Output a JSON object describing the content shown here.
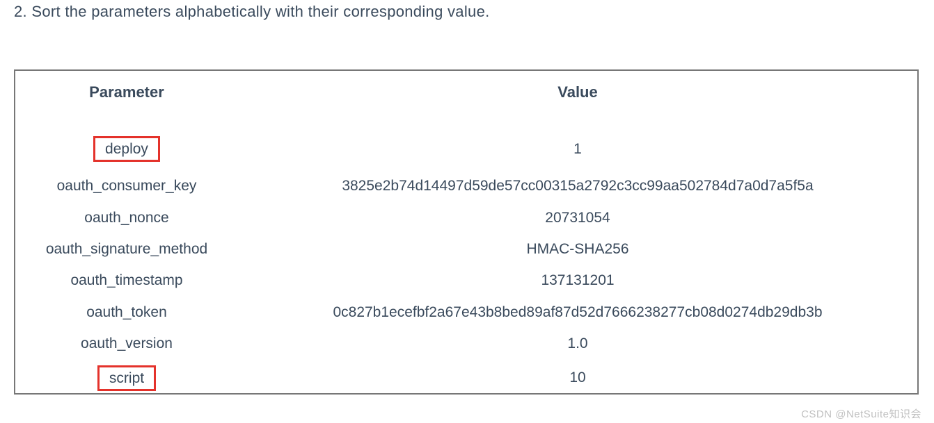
{
  "instruction": {
    "number": "2.",
    "text": "Sort the parameters alphabetically with their corresponding value."
  },
  "table": {
    "headers": {
      "param": "Parameter",
      "value": "Value"
    },
    "rows": [
      {
        "param": "deploy",
        "value": "1",
        "highlight": true,
        "cls": "row-deploy"
      },
      {
        "param": "oauth_consumer_key",
        "value": "3825e2b74d14497d59de57cc00315a2792c3cc99aa502784d7a0d7a5f5a",
        "highlight": false,
        "cls": ""
      },
      {
        "param": "oauth_nonce",
        "value": "20731054",
        "highlight": false,
        "cls": ""
      },
      {
        "param": "oauth_signature_method",
        "value": "HMAC-SHA256",
        "highlight": false,
        "cls": ""
      },
      {
        "param": "oauth_timestamp",
        "value": "137131201",
        "highlight": false,
        "cls": ""
      },
      {
        "param": "oauth_token",
        "value": "0c827b1ecefbf2a67e43b8bed89af87d52d7666238277cb08d0274db29db3b",
        "highlight": false,
        "cls": ""
      },
      {
        "param": "oauth_version",
        "value": "1.0",
        "highlight": false,
        "cls": ""
      },
      {
        "param": "script",
        "value": "10",
        "highlight": true,
        "cls": "row-script"
      }
    ]
  },
  "watermark": "CSDN @NetSuite知识会"
}
